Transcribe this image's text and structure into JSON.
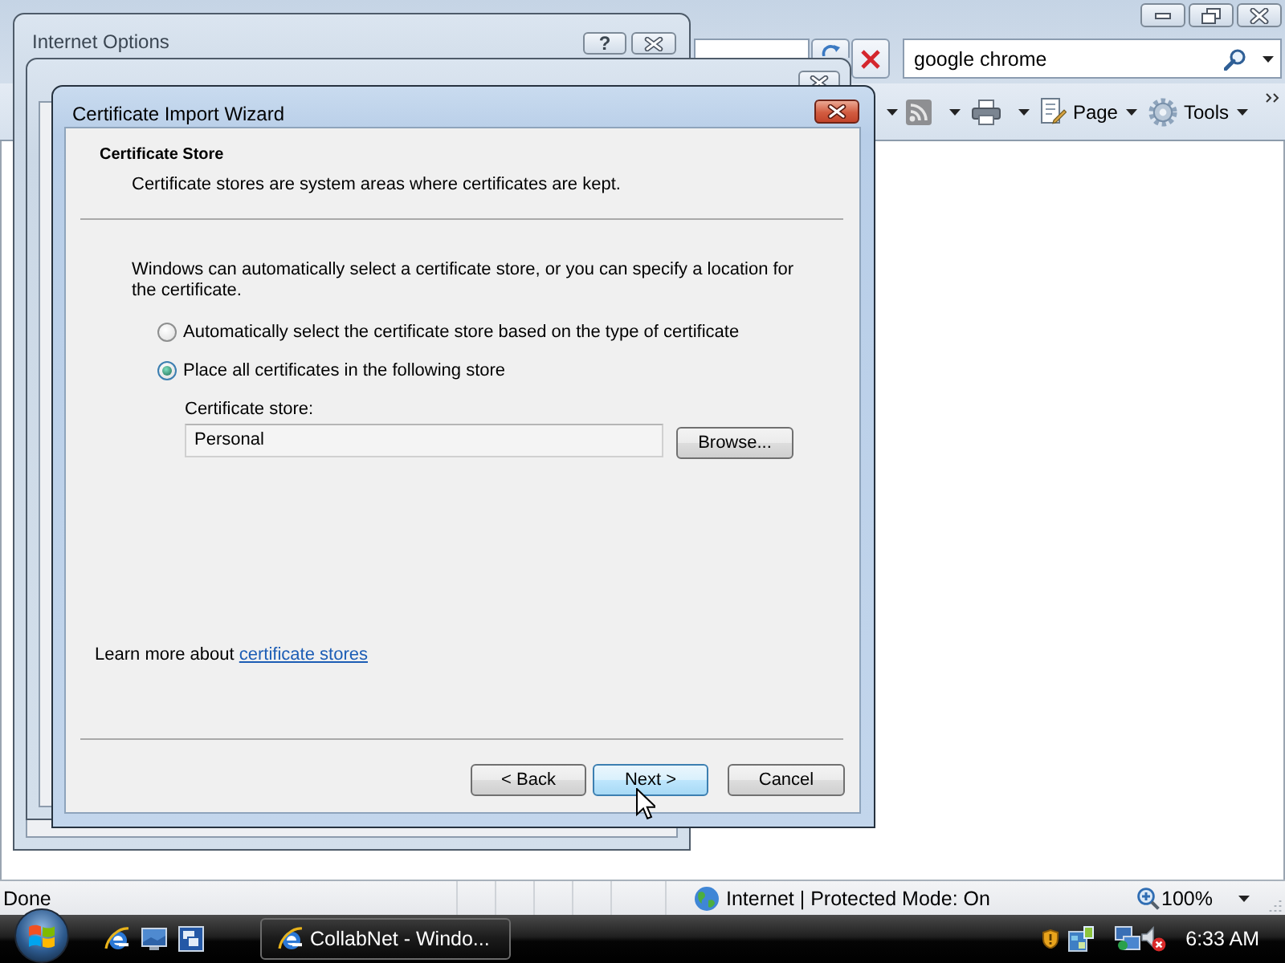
{
  "browser": {
    "search_field": {
      "value": "google chrome"
    },
    "toolbar": [
      {
        "kind": "feeds"
      },
      {
        "kind": "print"
      },
      {
        "kind": "page",
        "label": "Page"
      },
      {
        "kind": "tools",
        "label": "Tools"
      }
    ],
    "status_bar": {
      "text": "Done",
      "zone": "Internet | Protected Mode: On",
      "zoom": "100%"
    }
  },
  "internet_options": {
    "title": "Internet Options",
    "help_button": "?"
  },
  "wizard": {
    "title": "Certificate Import Wizard",
    "heading": "Certificate Store",
    "subheading": "Certificate stores are system areas where certificates are kept.",
    "intro": "Windows can automatically select a certificate store, or you can specify a location for the certificate.",
    "options": [
      {
        "label": "Automatically select the certificate store based on the type of certificate",
        "selected": false
      },
      {
        "label": "Place all certificates in the following store",
        "selected": true
      }
    ],
    "store_label": "Certificate store:",
    "store_field": {
      "value": "Personal"
    },
    "browse_button": "Browse...",
    "learn_more": {
      "text": "Learn more about",
      "link": "certificate stores"
    },
    "buttons": [
      {
        "label": "< Back",
        "hovered": false
      },
      {
        "label": "Next >",
        "hovered": true
      },
      {
        "label": "Cancel",
        "hovered": false
      }
    ]
  },
  "taskbar": {
    "tasks": [
      {
        "label": "CollabNet - Windo...",
        "selected": false
      }
    ],
    "clock": "6:33 AM"
  }
}
